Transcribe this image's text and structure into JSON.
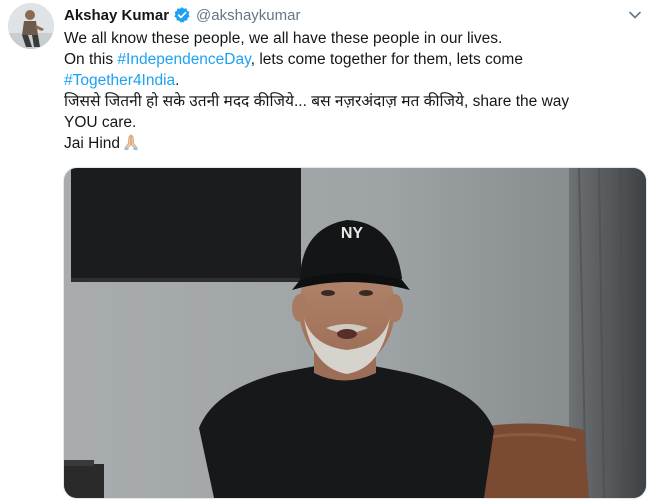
{
  "author": {
    "display_name": "Akshay Kumar",
    "handle": "@akshaykumar",
    "verified": true
  },
  "tweet": {
    "line1": "We all know these people, we all have these people in our lives.",
    "line2_prefix": "On this ",
    "hashtag1": "#IndependenceDay",
    "line2_suffix": ", lets come together for them, lets come",
    "hashtag2": "#Together4India",
    "line3_suffix": ".",
    "line4": "जिससे जितनी हो सके उतनी मदद कीजिये... बस नज़रअंदाज़ मत कीजिये, share the way",
    "line5": "YOU care.",
    "line6": "Jai Hind",
    "emoji": "folded-hands"
  },
  "media": {
    "type": "video-thumbnail"
  },
  "icons": {
    "menu": "chevron-down-icon",
    "verified": "verified-badge-icon"
  },
  "colors": {
    "hashtag": "#1da1f2",
    "verified": "#1da1f2",
    "text": "#14171a",
    "handle": "#657786"
  }
}
